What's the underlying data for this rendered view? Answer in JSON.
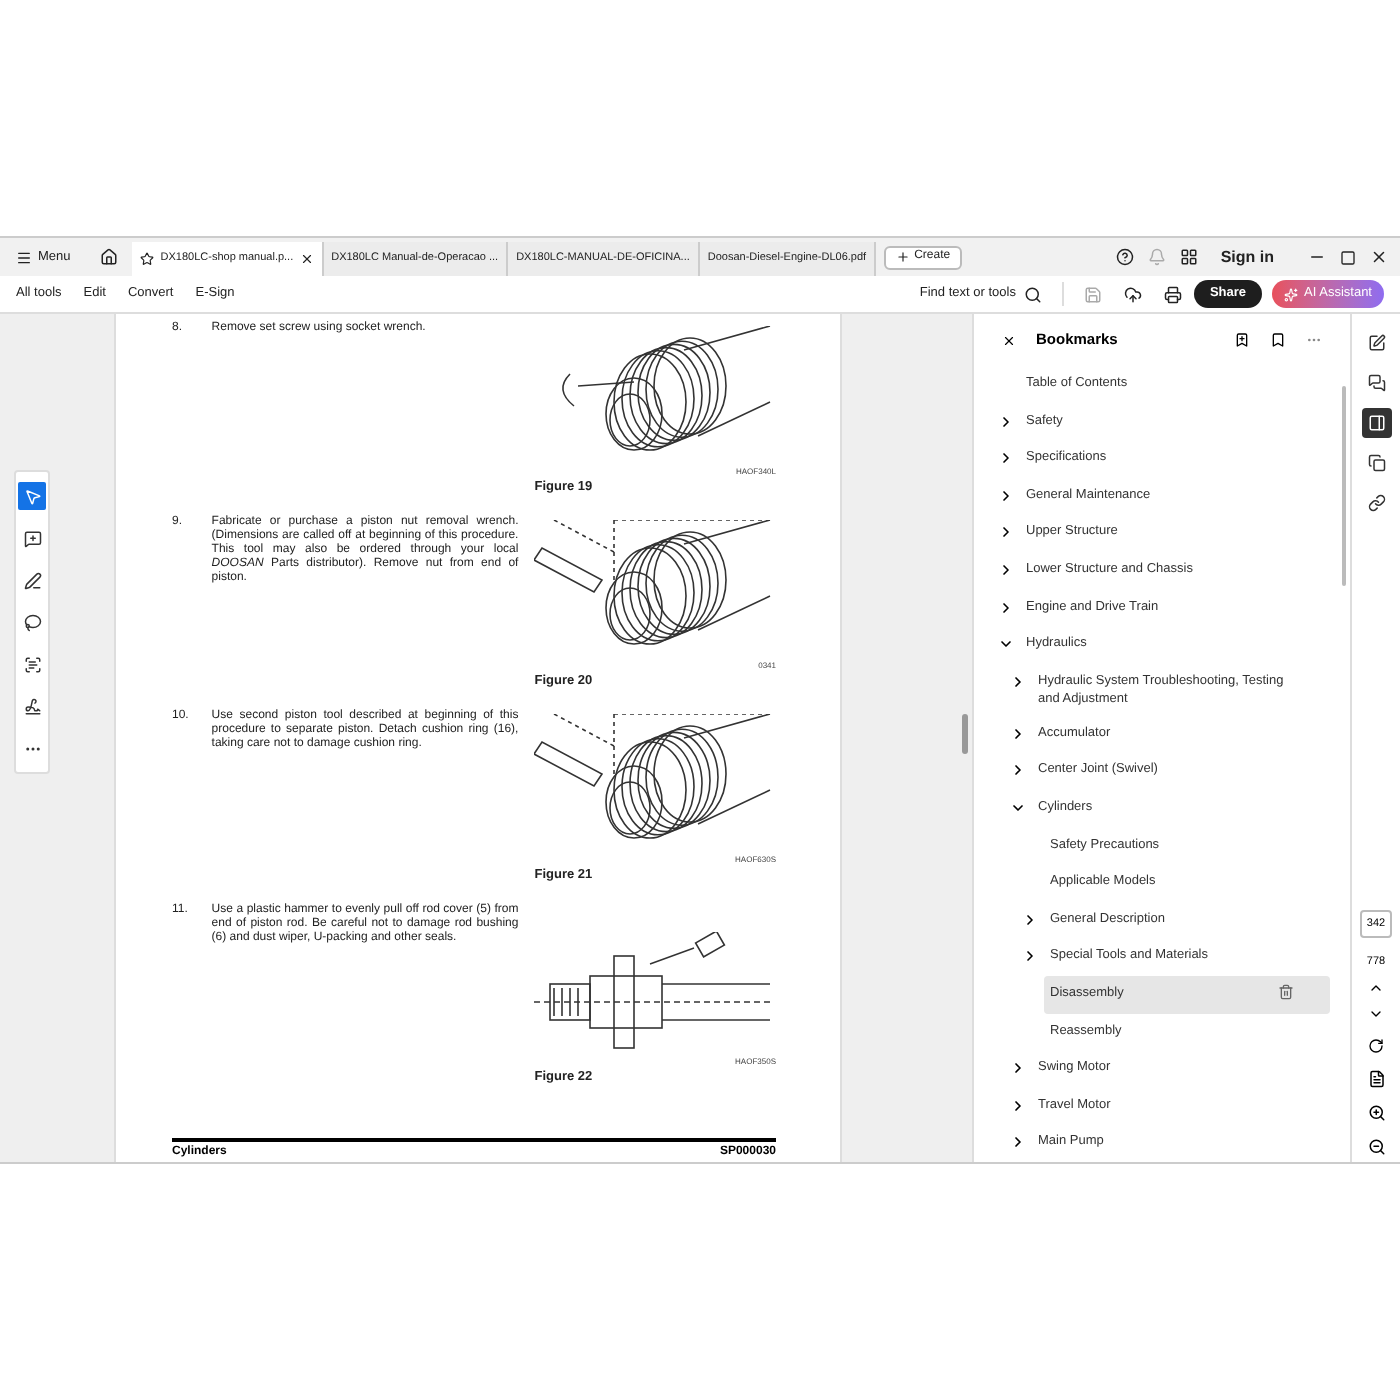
{
  "tab_bar": {
    "menu_label": "Menu",
    "tabs": [
      {
        "label": "DX180LC-shop manual.p...",
        "selected": true
      },
      {
        "label": "DX180LC Manual-de-Operacao ...",
        "selected": false
      },
      {
        "label": "DX180LC-MANUAL-DE-OFICINA...",
        "selected": false
      },
      {
        "label": "Doosan-Diesel-Engine-DL06.pdf",
        "selected": false
      }
    ],
    "create_label": "Create",
    "sign_in": "Sign in"
  },
  "toolbar": {
    "menu_items": [
      "All tools",
      "Edit",
      "Convert",
      "E-Sign"
    ],
    "find_label": "Find text or tools",
    "share_label": "Share",
    "ai_label": "AI Assistant"
  },
  "left_tools": [
    {
      "kind": "select",
      "selected": true
    },
    {
      "kind": "comment",
      "selected": false
    },
    {
      "kind": "draw",
      "selected": false
    },
    {
      "kind": "lasso",
      "selected": false
    },
    {
      "kind": "text",
      "selected": false
    },
    {
      "kind": "sign",
      "selected": false
    },
    {
      "kind": "more",
      "selected": false
    }
  ],
  "document": {
    "steps": [
      {
        "number": "8.",
        "text": "Remove set screw using socket wrench.",
        "figure": {
          "kind": "wrench",
          "caption": "Figure 19",
          "code": "HAOF340L"
        }
      },
      {
        "number": "9.",
        "text": "Fabricate or purchase a piston nut removal wrench. (Dimensions are called off at beginning of this procedure. This tool may also be ordered through your local *DOOSAN* Parts distributor). Remove nut from end of piston.",
        "figure": {
          "kind": "nut-wrench",
          "caption": "Figure 20",
          "code": "0341"
        }
      },
      {
        "number": "10.",
        "text": "Use second piston tool described at beginning of this procedure to separate piston. Detach cushion ring (16), taking care not to damage cushion ring.",
        "figure": {
          "kind": "nut-wrench",
          "caption": "Figure 21",
          "code": "HAOF630S"
        }
      },
      {
        "number": "11.",
        "text": "Use a plastic hammer to evenly pull off rod cover (5) from end of piston rod. Be careful not to damage rod bushing (6) and dust wiper, U-packing and other seals.",
        "figure": {
          "kind": "hammer",
          "caption": "Figure 22",
          "code": "HAOF350S"
        }
      }
    ],
    "footer": {
      "left": "Cylinders",
      "right": "SP000030"
    }
  },
  "bookmarks": {
    "title": "Bookmarks",
    "items": [
      {
        "label": "Table of Contents",
        "selected": false
      },
      {
        "label": "Safety",
        "expanded": false,
        "selected": false
      },
      {
        "label": "Specifications",
        "expanded": false,
        "selected": false
      },
      {
        "label": "General Maintenance",
        "expanded": false,
        "selected": false
      },
      {
        "label": "Upper Structure",
        "expanded": false,
        "selected": false
      },
      {
        "label": "Lower Structure and Chassis",
        "expanded": false,
        "selected": false
      },
      {
        "label": "Engine and Drive Train",
        "expanded": false,
        "selected": false
      },
      {
        "label": "Hydraulics",
        "expanded": true,
        "selected": false,
        "children": [
          {
            "label": "Hydraulic System Troubleshooting, Testing and Adjustment",
            "expanded": false,
            "selected": false
          },
          {
            "label": "Accumulator",
            "expanded": false,
            "selected": false
          },
          {
            "label": "Center Joint (Swivel)",
            "expanded": false,
            "selected": false
          },
          {
            "label": "Cylinders",
            "expanded": true,
            "selected": false,
            "children": [
              {
                "label": "Safety Precautions",
                "selected": false
              },
              {
                "label": "Applicable Models",
                "selected": false
              },
              {
                "label": "General Description",
                "expanded": false,
                "selected": false
              },
              {
                "label": "Special Tools and Materials",
                "expanded": false,
                "selected": false
              },
              {
                "label": "Disassembly",
                "selected": true
              },
              {
                "label": "Reassembly",
                "selected": false
              }
            ]
          },
          {
            "label": "Swing Motor",
            "expanded": false,
            "selected": false
          },
          {
            "label": "Travel Motor",
            "expanded": false,
            "selected": false
          },
          {
            "label": "Main Pump",
            "expanded": false,
            "selected": false
          }
        ]
      }
    ]
  },
  "right_rail": {
    "tools": [
      {
        "kind": "edit",
        "selected": false
      },
      {
        "kind": "comments",
        "selected": false
      },
      {
        "kind": "bookmarks",
        "selected": true
      },
      {
        "kind": "pages",
        "selected": false
      },
      {
        "kind": "links",
        "selected": false
      }
    ],
    "current_page": "342",
    "total_pages": "778"
  }
}
